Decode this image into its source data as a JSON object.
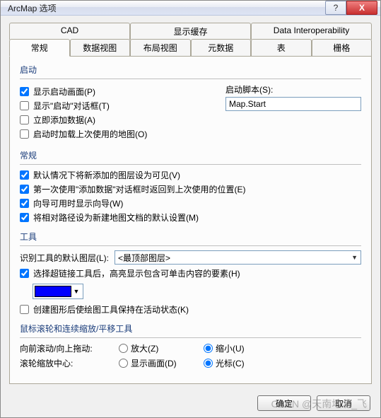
{
  "window": {
    "title": "ArcMap 选项",
    "help_glyph": "?",
    "close_glyph": "X"
  },
  "tabs_top": [
    {
      "label": "CAD"
    },
    {
      "label": "显示缓存"
    },
    {
      "label": "Data Interoperability"
    }
  ],
  "tabs_bottom": [
    {
      "label": "常规",
      "active": true
    },
    {
      "label": "数据视图"
    },
    {
      "label": "布局视图"
    },
    {
      "label": "元数据"
    },
    {
      "label": "表"
    },
    {
      "label": "栅格"
    }
  ],
  "startup": {
    "title": "启动",
    "show_splash": {
      "label": "显示启动画面(P)",
      "checked": true
    },
    "show_dialog": {
      "label": "显示\"启动\"对话框(T)",
      "checked": false
    },
    "add_data_now": {
      "label": "立即添加数据(A)",
      "checked": false
    },
    "load_last_map": {
      "label": "启动时加载上次使用的地图(O)",
      "checked": false
    },
    "script_label": "启动脚本(S):",
    "script_value": "Map.Start"
  },
  "general": {
    "title": "常规",
    "new_layers_visible": {
      "label": "默认情况下将新添加的图层设为可见(V)",
      "checked": true
    },
    "return_last_location": {
      "label": "第一次使用\"添加数据\"对话框时返回到上次使用的位置(E)",
      "checked": true
    },
    "show_wizards": {
      "label": "向导可用时显示向导(W)",
      "checked": true
    },
    "relative_paths": {
      "label": "将相对路径设为新建地图文档的默认设置(M)",
      "checked": true
    }
  },
  "tools": {
    "title": "工具",
    "identify_label": "识别工具的默认图层(L):",
    "identify_value": "<最顶部图层>",
    "hyperlink": {
      "label": "选择超链接工具后，高亮显示包含可单击内容的要素(H)",
      "checked": true
    },
    "color": "#0000ff",
    "keep_tool_active": {
      "label": "创建图形后使绘图工具保持在活动状态(K)",
      "checked": false
    }
  },
  "wheel": {
    "title": "鼠标滚轮和连续缩放/平移工具",
    "row1_label": "向前滚动/向上拖动:",
    "row2_label": "滚轮缩放中心:",
    "zoom_in": "放大(Z)",
    "zoom_out": "缩小(U)",
    "display": "显示画面(D)",
    "cursor": "光标(C)",
    "scroll_sel": "out",
    "center_sel": "cursor"
  },
  "buttons": {
    "ok": "确定",
    "cancel": "取消"
  },
  "watermark": "CSDN @天南地北_飞"
}
